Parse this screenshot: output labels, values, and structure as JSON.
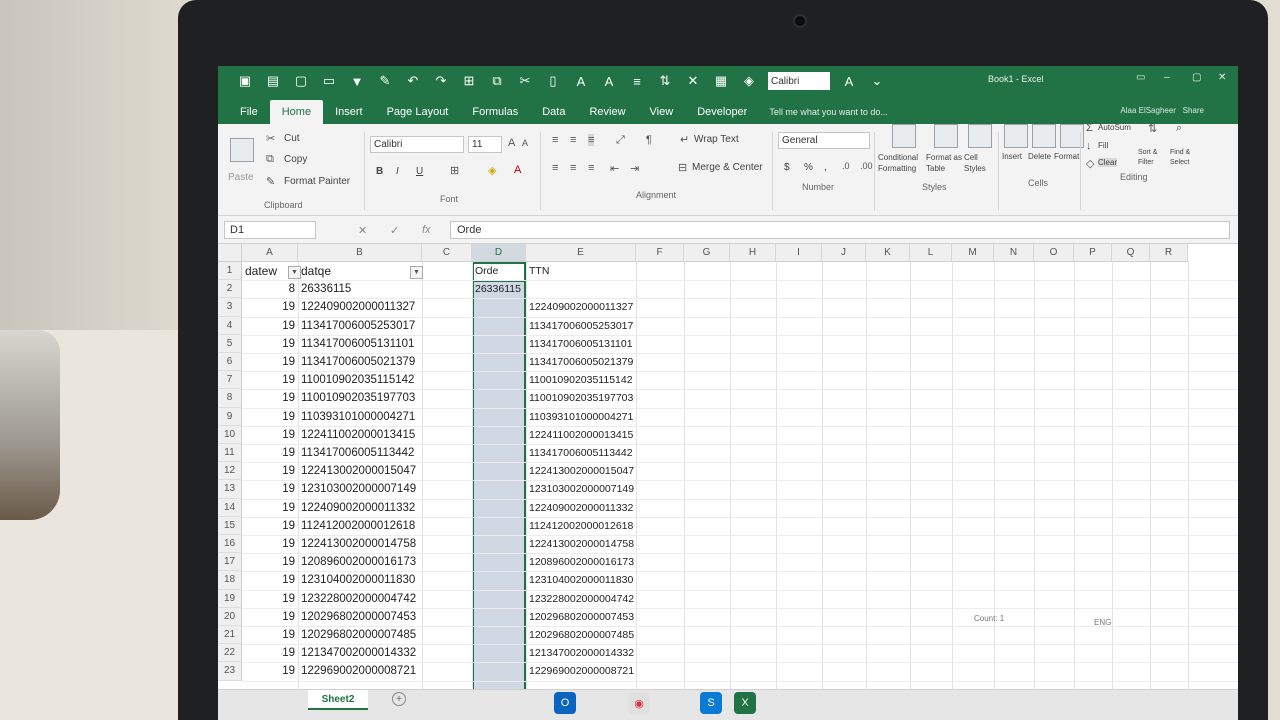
{
  "window": {
    "title": "Book1 - Excel",
    "user": "Alaa ElSagheer"
  },
  "quick_access": {
    "font_box": "Calibri"
  },
  "tabs": [
    "File",
    "Home",
    "Insert",
    "Page Layout",
    "Formulas",
    "Data",
    "Review",
    "View",
    "Developer"
  ],
  "tell_me": "Tell me what you want to do...",
  "share": "Share",
  "ribbon": {
    "clipboard": {
      "paste": "Paste",
      "cut": "Cut",
      "copy": "Copy",
      "format_painter": "Format Painter",
      "label": "Clipboard"
    },
    "font": {
      "name": "Calibri",
      "size": "11",
      "label": "Font",
      "bold": "B",
      "italic": "I",
      "underline": "U"
    },
    "alignment": {
      "wrap": "Wrap Text",
      "merge": "Merge & Center",
      "label": "Alignment"
    },
    "number": {
      "format": "General",
      "currency": "$",
      "percent": "%",
      "label": "Number"
    },
    "styles": {
      "conditional": "Conditional Formatting",
      "table": "Format as Table",
      "cell_styles": "Cell Styles",
      "label": "Styles"
    },
    "cells": {
      "insert": "Insert",
      "delete": "Delete",
      "format": "Format",
      "label": "Cells"
    },
    "editing": {
      "autosum": "AutoSum",
      "fill": "Fill",
      "clear": "Clear",
      "sort": "Sort & Filter",
      "find": "Find & Select",
      "label": "Editing"
    }
  },
  "name_box": "D1",
  "formula": "Orde",
  "columns": [
    "A",
    "B",
    "C",
    "D",
    "E",
    "F",
    "G",
    "H",
    "I",
    "J",
    "K",
    "L",
    "M",
    "N",
    "O",
    "P",
    "Q",
    "R"
  ],
  "rows": [
    "1",
    "2",
    "3",
    "4",
    "5",
    "6",
    "7",
    "8",
    "9",
    "10",
    "11",
    "12",
    "13",
    "14",
    "15",
    "16",
    "17",
    "18",
    "19",
    "20",
    "21",
    "22",
    "23"
  ],
  "headers": {
    "A": "datew",
    "B": "datqe",
    "D": "Orde",
    "E": "TTN"
  },
  "col_a": [
    "8",
    "19",
    "19",
    "19",
    "19",
    "19",
    "19",
    "19",
    "19",
    "19",
    "19",
    "19",
    "19",
    "19",
    "19",
    "19",
    "19",
    "19",
    "19",
    "19",
    "19",
    "19"
  ],
  "col_b": [
    "26336115",
    "122409002000011327",
    "113417006005253017",
    "113417006005131101",
    "113417006005021379",
    "110010902035115142",
    "110010902035197703",
    "110393101000004271",
    "122411002000013415",
    "113417006005113442",
    "122413002000015047",
    "123103002000007149",
    "122409002000011332",
    "112412002000012618",
    "122413002000014758",
    "120896002000016173",
    "123104002000011830",
    "123228002000004742",
    "120296802000007453",
    "120296802000007485",
    "121347002000014332",
    "122969002000008721"
  ],
  "col_d": [
    "26336115"
  ],
  "col_e": [
    "122409002000011327",
    "113417006005253017",
    "113417006005131101",
    "113417006005021379",
    "110010902035115142",
    "110010902035197703",
    "110393101000004271",
    "122411002000013415",
    "113417006005113442",
    "122413002000015047",
    "123103002000007149",
    "122409002000011332",
    "112412002000012618",
    "122413002000014758",
    "120896002000016173",
    "123104002000011830",
    "123228002000004742",
    "120296802000007453",
    "120296802000007485",
    "121347002000014332",
    "122969002000008721"
  ],
  "sheet": "Sheet2",
  "status": {
    "count": "Count: 1",
    "lang": "ENG"
  },
  "colors": {
    "excel_green": "#217346",
    "selection": "#cfd8e3"
  }
}
